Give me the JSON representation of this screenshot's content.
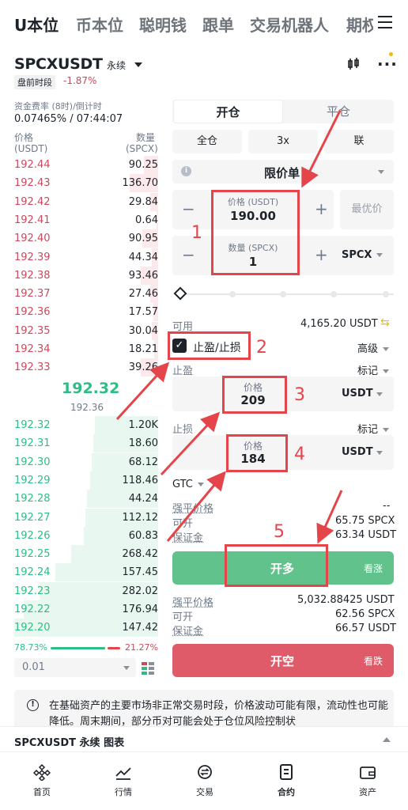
{
  "tabs": [
    "U本位",
    "币本位",
    "聪明钱",
    "跟单",
    "交易机器人",
    "期权"
  ],
  "symbol": {
    "name": "SPCXUSDT",
    "type": "永续",
    "session": "盘前时段",
    "change": "-1.87%"
  },
  "funding": {
    "label": "资金费率 (8时)/倒计时",
    "value": "0.07465% / 07:44:07"
  },
  "orderbook": {
    "price_label": "价格",
    "price_unit": "(USDT)",
    "qty_label": "数量",
    "qty_unit": "(SPCX)",
    "asks": [
      [
        "192.44",
        "90.25"
      ],
      [
        "192.43",
        "136.70"
      ],
      [
        "192.42",
        "29.84"
      ],
      [
        "192.41",
        "0.64"
      ],
      [
        "192.40",
        "90.95"
      ],
      [
        "192.39",
        "44.34"
      ],
      [
        "192.38",
        "93.46"
      ],
      [
        "192.37",
        "27.46"
      ],
      [
        "192.36",
        "17.57"
      ],
      [
        "192.35",
        "30.04"
      ],
      [
        "192.34",
        "18.21"
      ],
      [
        "192.33",
        "39.26"
      ]
    ],
    "mid_price": "192.32",
    "mark_price": "192.36",
    "bids": [
      [
        "192.32",
        "1.20K"
      ],
      [
        "192.31",
        "18.60"
      ],
      [
        "192.30",
        "68.12"
      ],
      [
        "192.29",
        "118.46"
      ],
      [
        "192.28",
        "44.24"
      ],
      [
        "192.27",
        "112.12"
      ],
      [
        "192.26",
        "60.83"
      ],
      [
        "192.25",
        "268.42"
      ],
      [
        "192.24",
        "157.45"
      ],
      [
        "192.23",
        "282.02"
      ],
      [
        "192.22",
        "176.94"
      ],
      [
        "192.20",
        "147.42"
      ]
    ],
    "buy_ratio": "78.73%",
    "sell_ratio": "21.27%",
    "buy_ratio_value": 0.7873,
    "precision": "0.01"
  },
  "form": {
    "open": "开仓",
    "close": "平仓",
    "margin": "全仓",
    "leverage": "3x",
    "mode": "联",
    "order_type": "限价单",
    "price_label": "价格 (USDT)",
    "price": "190.00",
    "best_price": "最优价",
    "qty_label": "数量 (SPCX)",
    "qty": "1",
    "qty_unit": "SPCX",
    "available_label": "可用",
    "available": "4,165.20 USDT",
    "tpsl": "止盈/止损",
    "advanced": "高级",
    "tp_label": "止盈",
    "tp_trigger": "标记",
    "tp_price_label": "价格",
    "tp_price": "209",
    "tp_unit": "USDT",
    "sl_label": "止损",
    "sl_trigger": "标记",
    "sl_price_label": "价格",
    "sl_price": "184",
    "sl_unit": "USDT",
    "gtc": "GTC",
    "long_liq_label": "强平价格",
    "long_liq": "--",
    "long_open_label": "可开",
    "long_open": "65.75 SPCX",
    "long_margin_label": "保证金",
    "long_margin": "63.34 USDT",
    "long_btn": "开多",
    "long_sub": "看涨",
    "short_liq_label": "强平价格",
    "short_liq": "5,032.88425 USDT",
    "short_open_label": "可开",
    "short_open": "62.56 SPCX",
    "short_margin_label": "保证金",
    "short_margin": "66.57 USDT",
    "short_btn": "开空",
    "short_sub": "看跌"
  },
  "annotations": [
    "1",
    "2",
    "3",
    "4",
    "5"
  ],
  "notice": "在基础资产的主要市场非正常交易时段，价格波动可能有限，流动性也可能降低。周末期间，部分币对可能会处于仓位风险控制状",
  "chart_bar": "SPCXUSDT 永续 图表",
  "bottom": [
    "首页",
    "行情",
    "交易",
    "合约",
    "资产"
  ],
  "colors": {
    "green": "#2ebd85",
    "red": "#c94a5c",
    "annotation": "#e4454a"
  }
}
